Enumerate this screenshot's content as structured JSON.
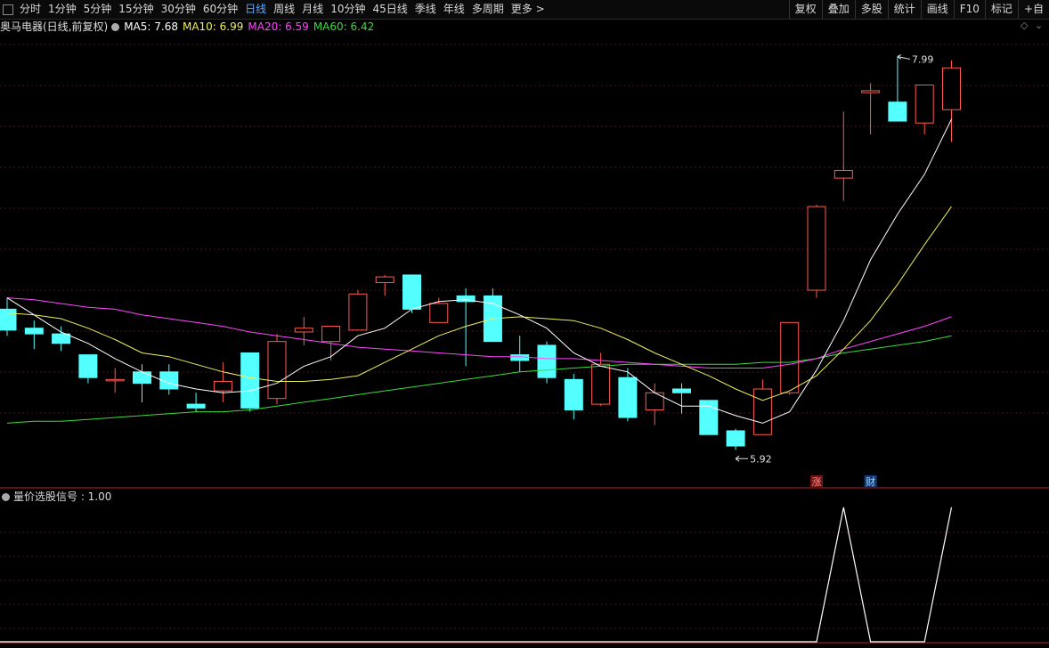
{
  "toolbar": {
    "periods": [
      "分时",
      "1分钟",
      "5分钟",
      "15分钟",
      "30分钟",
      "60分钟",
      "日线",
      "周线",
      "月线",
      "10分钟",
      "45日线",
      "季线",
      "年线",
      "多周期",
      "更多 >"
    ],
    "active": "日线",
    "right_buttons": [
      "复权",
      "叠加",
      "多股",
      "统计",
      "画线",
      "F10",
      "标记",
      "+自"
    ]
  },
  "info": {
    "stock": "奥马电器(日线,前复权)",
    "ma5": "MA5: 7.68",
    "ma10": "MA10: 6.99",
    "ma20": "MA20: 6.59",
    "ma60": "MA60: 6.42"
  },
  "sub_info": {
    "label": "量价选股信号 : 1.00"
  },
  "colors": {
    "up": "#ff5a50",
    "down": "#54ffff",
    "ma5": "#ffffff",
    "ma10": "#f0f05a",
    "ma20": "#ff46ff",
    "ma60": "#3cdc3c",
    "active_tab": "#5aa8ff",
    "divider": "#b4282d"
  },
  "chart_data": [
    {
      "type": "candlestick",
      "ylim": [
        5.72,
        8.1
      ],
      "high_label": "7.99",
      "low_label": "5.92",
      "markers": [
        {
          "bar": 30,
          "text": "涨"
        },
        {
          "bar": 32,
          "text": "财"
        }
      ],
      "candles": [
        [
          6.66,
          6.72,
          6.52,
          6.55
        ],
        [
          6.56,
          6.6,
          6.45,
          6.53
        ],
        [
          6.53,
          6.57,
          6.44,
          6.48
        ],
        [
          6.42,
          6.42,
          6.27,
          6.3
        ],
        [
          6.29,
          6.35,
          6.22,
          6.29
        ],
        [
          6.33,
          6.37,
          6.17,
          6.27
        ],
        [
          6.33,
          6.37,
          6.21,
          6.24
        ],
        [
          6.16,
          6.22,
          6.12,
          6.14
        ],
        [
          6.23,
          6.38,
          6.17,
          6.28
        ],
        [
          6.43,
          6.43,
          6.12,
          6.14
        ],
        [
          6.19,
          6.53,
          6.16,
          6.49
        ],
        [
          6.54,
          6.62,
          6.47,
          6.56
        ],
        [
          6.49,
          6.57,
          6.39,
          6.57
        ],
        [
          6.55,
          6.76,
          6.55,
          6.74
        ],
        [
          6.8,
          6.84,
          6.73,
          6.83
        ],
        [
          6.84,
          6.84,
          6.64,
          6.66
        ],
        [
          6.59,
          6.72,
          6.59,
          6.69
        ],
        [
          6.73,
          6.77,
          6.36,
          6.7
        ],
        [
          6.73,
          6.77,
          6.49,
          6.49
        ],
        [
          6.42,
          6.52,
          6.33,
          6.39
        ],
        [
          6.47,
          6.49,
          6.27,
          6.3
        ],
        [
          6.29,
          6.32,
          6.08,
          6.13
        ],
        [
          6.16,
          6.43,
          6.15,
          6.37
        ],
        [
          6.3,
          6.35,
          6.07,
          6.09
        ],
        [
          6.13,
          6.27,
          6.05,
          6.22
        ],
        [
          6.24,
          6.27,
          6.11,
          6.22
        ],
        [
          6.18,
          6.18,
          6.0,
          6.0
        ],
        [
          6.02,
          6.03,
          5.92,
          5.94
        ],
        [
          6.0,
          6.29,
          6.0,
          6.24
        ],
        [
          6.22,
          6.59,
          6.21,
          6.59
        ],
        [
          6.76,
          7.21,
          6.72,
          7.2
        ],
        [
          7.35,
          7.7,
          7.23,
          7.39
        ],
        [
          7.8,
          7.85,
          7.58,
          7.81
        ],
        [
          7.75,
          7.99,
          7.68,
          7.65
        ],
        [
          7.64,
          7.84,
          7.58,
          7.84
        ],
        [
          7.71,
          7.97,
          7.54,
          7.93
        ]
      ],
      "ma5": [
        6.72,
        6.63,
        6.54,
        6.48,
        6.4,
        6.33,
        6.27,
        6.24,
        6.22,
        6.23,
        6.27,
        6.36,
        6.41,
        6.52,
        6.56,
        6.66,
        6.7,
        6.71,
        6.69,
        6.63,
        6.56,
        6.43,
        6.36,
        6.33,
        6.22,
        6.15,
        6.15,
        6.1,
        6.06,
        6.12,
        6.34,
        6.6,
        6.92,
        7.16,
        7.37,
        7.66
      ],
      "ma10": [
        6.64,
        6.63,
        6.61,
        6.56,
        6.5,
        6.43,
        6.41,
        6.37,
        6.33,
        6.3,
        6.28,
        6.28,
        6.29,
        6.31,
        6.38,
        6.45,
        6.52,
        6.57,
        6.61,
        6.62,
        6.61,
        6.6,
        6.56,
        6.5,
        6.43,
        6.37,
        6.31,
        6.24,
        6.18,
        6.23,
        6.31,
        6.45,
        6.6,
        6.79,
        7.0,
        7.2
      ],
      "ma20": [
        6.72,
        6.71,
        6.69,
        6.67,
        6.66,
        6.63,
        6.61,
        6.59,
        6.57,
        6.54,
        6.52,
        6.5,
        6.48,
        6.46,
        6.45,
        6.44,
        6.43,
        6.42,
        6.41,
        6.41,
        6.4,
        6.4,
        6.39,
        6.38,
        6.37,
        6.36,
        6.35,
        6.35,
        6.35,
        6.37,
        6.4,
        6.45,
        6.49,
        6.53,
        6.57,
        6.62
      ],
      "ma60": [
        6.06,
        6.07,
        6.07,
        6.08,
        6.09,
        6.1,
        6.11,
        6.12,
        6.12,
        6.13,
        6.15,
        6.17,
        6.19,
        6.21,
        6.23,
        6.25,
        6.27,
        6.29,
        6.31,
        6.33,
        6.34,
        6.35,
        6.36,
        6.37,
        6.37,
        6.37,
        6.37,
        6.37,
        6.38,
        6.38,
        6.4,
        6.43,
        6.45,
        6.47,
        6.49,
        6.52
      ]
    },
    {
      "type": "line",
      "series": [
        {
          "name": "量价选股信号",
          "values": [
            0,
            0,
            0,
            0,
            0,
            0,
            0,
            0,
            0,
            0,
            0,
            0,
            0,
            0,
            0,
            0,
            0,
            0,
            0,
            0,
            0,
            0,
            0,
            0,
            0,
            0,
            0,
            0,
            0,
            0,
            0,
            1,
            0,
            0,
            0,
            1
          ]
        }
      ],
      "ylim": [
        0,
        1
      ]
    }
  ]
}
